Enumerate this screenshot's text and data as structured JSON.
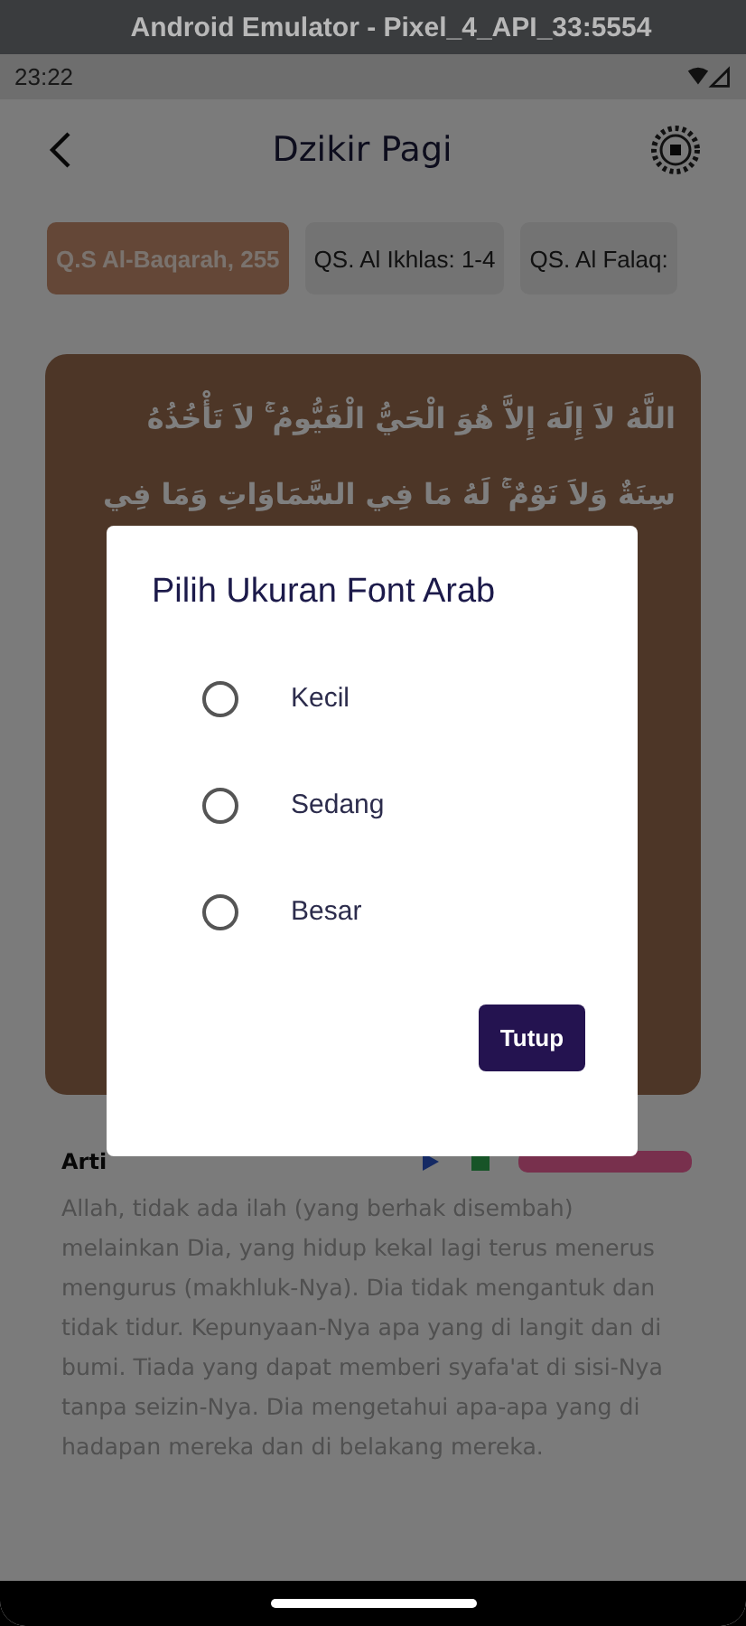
{
  "window": {
    "title": "Android Emulator - Pixel_4_API_33:5554"
  },
  "status_bar": {
    "time": "23:22"
  },
  "app_bar": {
    "title": "Dzikir Pagi"
  },
  "tabs": [
    {
      "label": "Q.S Al-Baqarah, 255",
      "selected": true
    },
    {
      "label": "QS. Al Ikhlas: 1-4",
      "selected": false
    },
    {
      "label": "QS. Al Falaq:",
      "selected": false
    }
  ],
  "arabic_lines": [
    "اللَّهُ لاَ إِلَهَ إِلاَّ هُوَ الْحَيُّ الْقَيُّومُ ۚ لاَ تَأْخُذُهُ",
    "سِنَةٌ وَلاَ نَوْمٌ ۚ لَهُ مَا فِي السَّمَاوَاتِ وَمَا فِي"
  ],
  "meaning": {
    "label": "Arti",
    "text": "Allah, tidak ada ilah (yang berhak disembah) melainkan Dia, yang hidup kekal lagi terus menerus mengurus (makhluk-Nya). Dia tidak mengantuk dan tidak tidur. Kepunyaan-Nya apa yang di langit dan di bumi. Tiada yang dapat memberi syafa'at di sisi-Nya tanpa seizin-Nya. Dia mengetahui apa-apa yang di hadapan mereka dan di belakang mereka."
  },
  "dialog": {
    "title": "Pilih Ukuran Font Arab",
    "options": [
      {
        "label": "Kecil",
        "selected": false
      },
      {
        "label": "Sedang",
        "selected": false
      },
      {
        "label": "Besar",
        "selected": false
      }
    ],
    "button": "Tutup"
  }
}
